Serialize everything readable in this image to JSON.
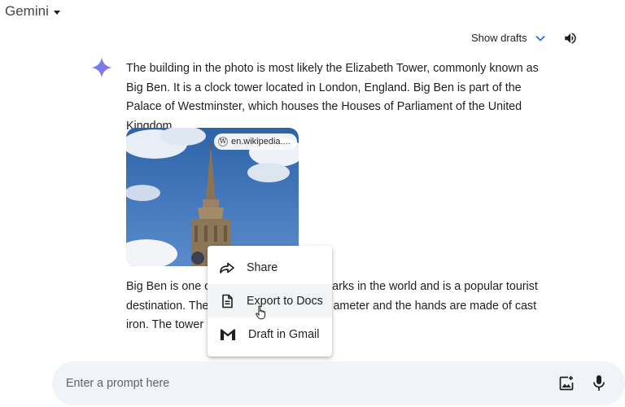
{
  "header": {
    "app_title": "Gemini",
    "show_drafts_label": "Show drafts"
  },
  "response": {
    "paragraph1": "The building in the photo is most likely the Elizabeth Tower, commonly known as Big Ben. It is a clock tower located in London, England. Big Ben is part of the Palace of Westminster, which houses the Houses of Parliament of the United Kingdom.",
    "image_source": "en.wikipedia....",
    "paragraph2_lines": [
      {
        "left": "Big Ben is one o",
        "right": "arks in the world and is a popular tourist"
      },
      {
        "left": "destination. The",
        "right": "ameter and the hands are made of cast"
      },
      {
        "left": "iron. The tower is",
        "right": ""
      }
    ]
  },
  "share_menu": {
    "items": [
      {
        "label": "Share",
        "icon": "share-arrow-icon"
      },
      {
        "label": "Export to Docs",
        "icon": "docs-icon"
      },
      {
        "label": "Draft in Gmail",
        "icon": "gmail-icon"
      }
    ],
    "hovered_index": 1
  },
  "prompt": {
    "placeholder": "Enter a prompt here"
  },
  "colors": {
    "accent_blue": "#1a73e8",
    "prompt_bg": "#f0f4f9",
    "menu_hover": "#f1f3f4"
  }
}
